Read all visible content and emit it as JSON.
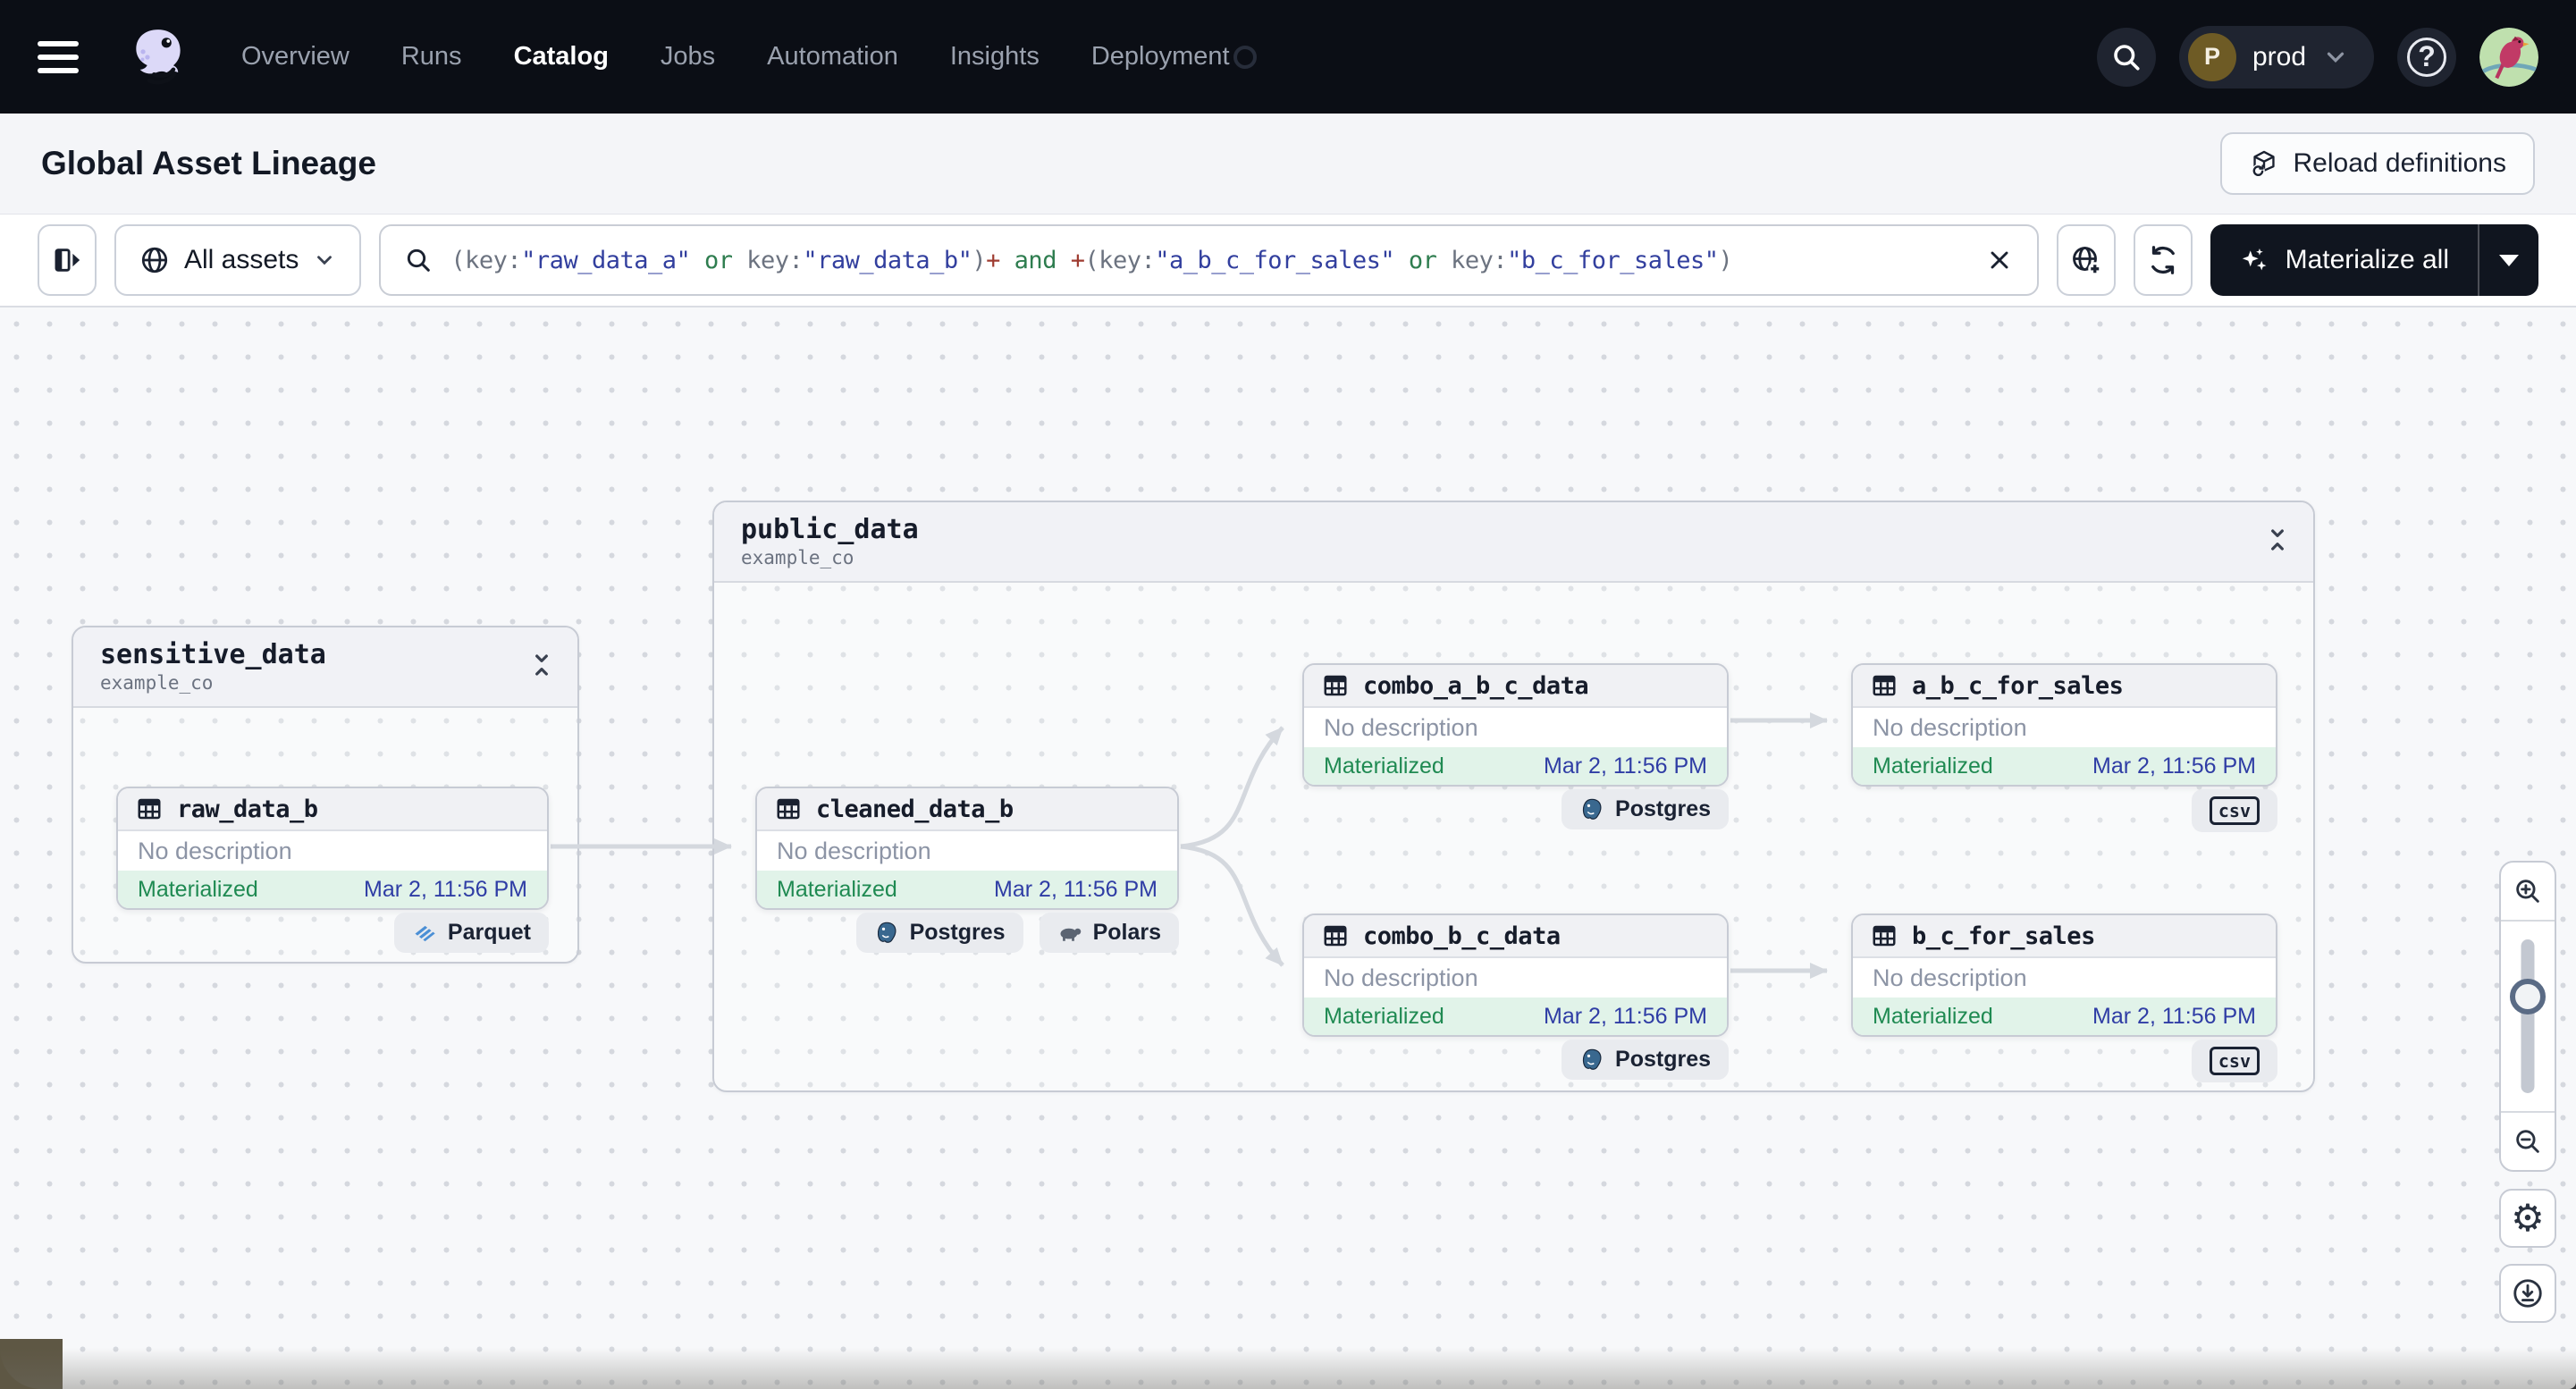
{
  "nav": {
    "items": [
      {
        "label": "Overview"
      },
      {
        "label": "Runs"
      },
      {
        "label": "Catalog"
      },
      {
        "label": "Jobs"
      },
      {
        "label": "Automation"
      },
      {
        "label": "Insights"
      },
      {
        "label": "Deployment"
      }
    ],
    "active_item": "Catalog",
    "workspace": {
      "initial": "P",
      "label": "prod"
    }
  },
  "header": {
    "title": "Global Asset Lineage",
    "reload_label": "Reload definitions"
  },
  "toolbar": {
    "scope_label": "All assets",
    "materialize_label": "Materialize all",
    "search": {
      "segments": [
        {
          "text": "(key:",
          "role": "symbol"
        },
        {
          "text": "\"raw_data_a\"",
          "role": "value"
        },
        {
          "text": " or ",
          "role": "operator"
        },
        {
          "text": "key:",
          "role": "symbol"
        },
        {
          "text": "\"raw_data_b\"",
          "role": "value"
        },
        {
          "text": ")",
          "role": "symbol"
        },
        {
          "text": "+",
          "role": "traversal"
        },
        {
          "text": " and ",
          "role": "operator"
        },
        {
          "text": "+",
          "role": "traversal"
        },
        {
          "text": "(key:",
          "role": "symbol"
        },
        {
          "text": "\"a_b_c_for_sales\"",
          "role": "value"
        },
        {
          "text": " or ",
          "role": "operator"
        },
        {
          "text": "key:",
          "role": "symbol"
        },
        {
          "text": "\"b_c_for_sales\"",
          "role": "value"
        },
        {
          "text": ")",
          "role": "symbol"
        }
      ]
    }
  },
  "graph": {
    "groups": [
      {
        "name": "sensitive_data",
        "location": "example_co"
      },
      {
        "name": "public_data",
        "location": "example_co"
      }
    ],
    "assets": [
      {
        "name": "raw_data_b",
        "description": "No description",
        "status": "Materialized",
        "timestamp": "Mar 2, 11:56 PM",
        "kinds": [
          {
            "kind": "parquet",
            "label": "Parquet"
          }
        ]
      },
      {
        "name": "cleaned_data_b",
        "description": "No description",
        "status": "Materialized",
        "timestamp": "Mar 2, 11:56 PM",
        "kinds": [
          {
            "kind": "postgres",
            "label": "Postgres"
          },
          {
            "kind": "polars",
            "label": "Polars"
          }
        ]
      },
      {
        "name": "combo_a_b_c_data",
        "description": "No description",
        "status": "Materialized",
        "timestamp": "Mar 2, 11:56 PM",
        "kinds": [
          {
            "kind": "postgres",
            "label": "Postgres"
          }
        ]
      },
      {
        "name": "a_b_c_for_sales",
        "description": "No description",
        "status": "Materialized",
        "timestamp": "Mar 2, 11:56 PM",
        "kinds": [
          {
            "kind": "csv",
            "label": "csv"
          }
        ]
      },
      {
        "name": "combo_b_c_data",
        "description": "No description",
        "status": "Materialized",
        "timestamp": "Mar 2, 11:56 PM",
        "kinds": [
          {
            "kind": "postgres",
            "label": "Postgres"
          }
        ]
      },
      {
        "name": "b_c_for_sales",
        "description": "No description",
        "status": "Materialized",
        "timestamp": "Mar 2, 11:56 PM",
        "kinds": [
          {
            "kind": "csv",
            "label": "csv"
          }
        ]
      }
    ],
    "edges": [
      {
        "from": "raw_data_b",
        "to": "cleaned_data_b"
      },
      {
        "from": "cleaned_data_b",
        "to": "combo_a_b_c_data"
      },
      {
        "from": "cleaned_data_b",
        "to": "combo_b_c_data"
      },
      {
        "from": "combo_a_b_c_data",
        "to": "a_b_c_for_sales"
      },
      {
        "from": "combo_b_c_data",
        "to": "b_c_for_sales"
      }
    ]
  },
  "colors": {
    "nav_background": "#0B0E15",
    "materialized_green": "#1F8A52",
    "materialized_bg": "#E1F3E9",
    "timestamp_indigo": "#2F3DA5",
    "query_value": "#323F9E",
    "query_operator": "#2E7D4F",
    "query_symbol": "#6C7380",
    "query_traversal": "#9E3B30",
    "edge_gray": "#D4D8DE"
  }
}
